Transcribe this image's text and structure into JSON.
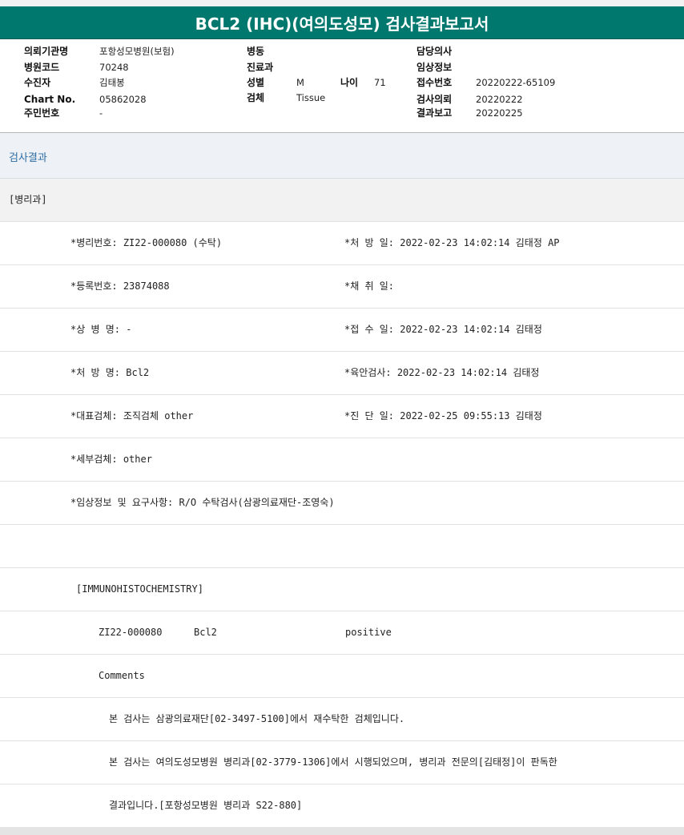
{
  "report": {
    "title": "BCL2 (IHC)(여의도성모) 검사결과보고서"
  },
  "header": {
    "col1": [
      {
        "label": "의뢰기관명",
        "value": "포항성모병원(보험)"
      },
      {
        "label": "병원코드",
        "value": "70248"
      },
      {
        "label": "수진자",
        "value": "김태봉"
      },
      {
        "label": "Chart No.",
        "value": "05862028"
      },
      {
        "label": "주민번호",
        "value": "-"
      }
    ],
    "col2": [
      {
        "label": "병동",
        "value": ""
      },
      {
        "label": "진료과",
        "value": ""
      },
      {
        "label": "성별",
        "value": "M"
      },
      {
        "label": "검체",
        "value": "Tissue"
      }
    ],
    "age": {
      "label": "나이",
      "value": "71"
    },
    "col3": [
      {
        "label": "담당의사",
        "value": ""
      },
      {
        "label": "임상정보",
        "value": ""
      },
      {
        "label": "접수번호",
        "value": "20220222-65109"
      },
      {
        "label": "검사의뢰",
        "value": "20220222"
      },
      {
        "label": "결과보고",
        "value": "20220225"
      }
    ]
  },
  "results": {
    "section_title": "검사결과",
    "rows": [
      {
        "cells": [
          "[병리과]"
        ]
      },
      {
        "cells": [
          "*병리번호: ZI22-000080 (수탁)",
          "*처 방 일: 2022-02-23 14:02:14  김태정 AP"
        ]
      },
      {
        "cells": [
          "*등록번호: 23874088",
          "*채 취 일:"
        ]
      },
      {
        "cells": [
          "*상 병 명: -",
          "*접 수 일: 2022-02-23 14:02:14  김태정"
        ]
      },
      {
        "cells": [
          "*처 방 명: Bcl2",
          "*육안검사: 2022-02-23 14:02:14  김태정"
        ]
      },
      {
        "cells": [
          "*대표검체: 조직검체 other",
          "*진 단 일: 2022-02-25 09:55:13  김태정"
        ]
      },
      {
        "cells": [
          "*세부검체: other"
        ]
      },
      {
        "cells": [
          "*임상정보 및 요구사항: R/O 수탁검사(삼광의료재단-조영숙)"
        ]
      },
      {
        "cells": [
          ""
        ]
      },
      {
        "cells": [
          "[IMMUNOHISTOCHEMISTRY]"
        ]
      },
      {
        "cells": [
          "ZI22-000080",
          "Bcl2",
          "positive"
        ]
      },
      {
        "cells": [
          "Comments"
        ]
      },
      {
        "cells": [
          "본 검사는 삼광의료재단[02-3497-5100]에서 재수탁한 검체입니다."
        ]
      },
      {
        "cells": [
          "본 검사는 여의도성모병원 병리과[02-3779-1306]에서 시행되었으며, 병리과 전문의[김태정]이 판독한"
        ]
      },
      {
        "cells": [
          "결과입니다.[포항성모병원 병리과 S22-880]"
        ]
      }
    ]
  }
}
